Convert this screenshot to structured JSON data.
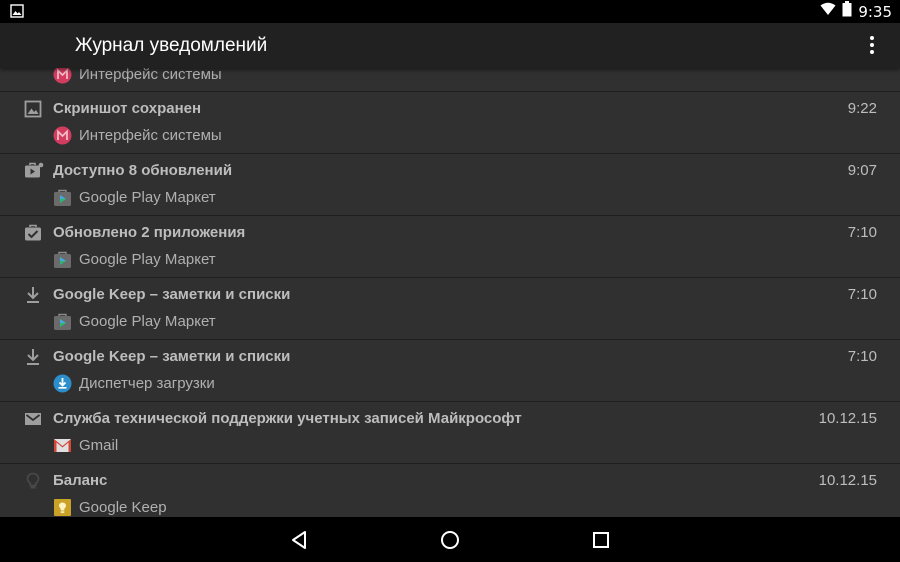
{
  "status_bar": {
    "time": "9:35",
    "icons": [
      "image-notification-icon",
      "wifi-icon",
      "battery-icon"
    ]
  },
  "toolbar": {
    "title": "Журнал уведомлений",
    "menu_icon": "overflow-menu-icon"
  },
  "notifications": [
    {
      "title": "",
      "time": "",
      "app": "Интерфейс системы",
      "icon": "",
      "app_icon": "system-ui-icon",
      "partial": true
    },
    {
      "title": "Скриншот сохранен",
      "time": "9:22",
      "app": "Интерфейс системы",
      "icon": "image-icon",
      "app_icon": "system-ui-icon"
    },
    {
      "title": "Доступно 8 обновлений",
      "time": "9:07",
      "app": "Google Play Маркет",
      "icon": "updates-available-icon",
      "app_icon": "play-store-icon"
    },
    {
      "title": "Обновлено 2 приложения",
      "time": "7:10",
      "app": "Google Play Маркет",
      "icon": "updated-check-icon",
      "app_icon": "play-store-icon"
    },
    {
      "title": "Google Keep – заметки и списки",
      "time": "7:10",
      "app": "Google Play Маркет",
      "icon": "download-icon",
      "app_icon": "play-store-icon"
    },
    {
      "title": "Google Keep – заметки и списки",
      "time": "7:10",
      "app": "Диспетчер загрузки",
      "icon": "download-icon",
      "app_icon": "download-manager-icon"
    },
    {
      "title": "Служба технической поддержки учетных записей Майкрософт",
      "time": "10.12.15",
      "app": "Gmail",
      "icon": "mail-icon",
      "app_icon": "gmail-icon"
    },
    {
      "title": "Баланс",
      "time": "10.12.15",
      "app": "Google Keep",
      "icon": "lightbulb-icon",
      "app_icon": "keep-icon"
    }
  ],
  "nav_bar": {
    "back": "back-icon",
    "home": "home-icon",
    "recents": "recents-icon"
  },
  "colors": {
    "background": "#303030",
    "toolbar": "#212121",
    "status_bar": "#000000"
  }
}
